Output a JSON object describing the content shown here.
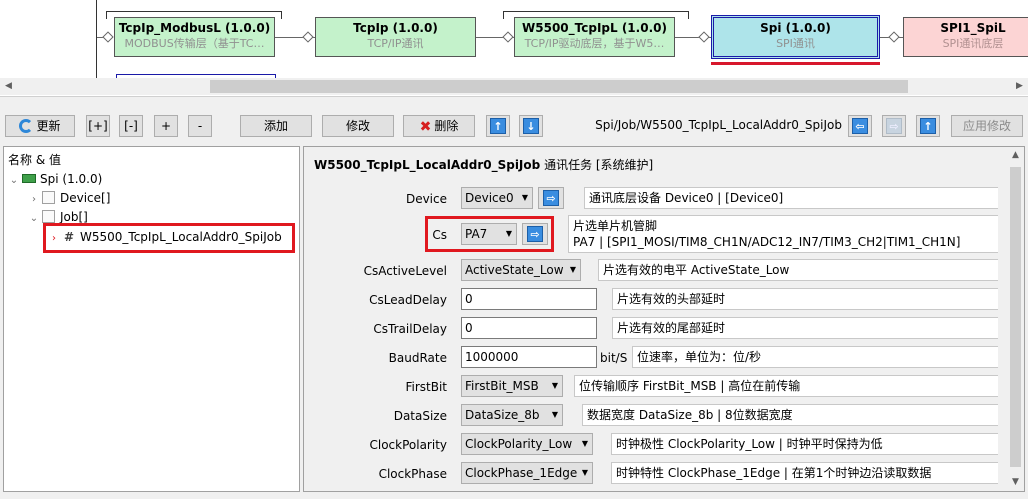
{
  "diagram": {
    "nodes": [
      {
        "title": "TcpIp_ModbusL (1.0.0)",
        "subtitle": "MODBUS传输层（基于TC…"
      },
      {
        "title": "TcpIp (1.0.0)",
        "subtitle": "TCP/IP通讯"
      },
      {
        "title": "W5500_TcpIpL (1.0.0)",
        "subtitle": "TCP/IP驱动底层，基于W5…"
      },
      {
        "title": "Spi (1.0.0)",
        "subtitle": "SPI通讯"
      },
      {
        "title": "SPI1_SpiL",
        "subtitle": "SPI通讯底层"
      }
    ]
  },
  "toolbar": {
    "refresh": "更新",
    "expand": "[+]",
    "collapse": "[-]",
    "plus": "+",
    "minus": "-",
    "add": "添加",
    "edit": "修改",
    "delete": "删除",
    "up_icon": "↑",
    "down_icon": "↓",
    "path": "Spi/Job/W5500_TcpIpL_LocalAddr0_SpiJob",
    "back_icon": "⇦",
    "forward_icon": "⇨",
    "parent_icon": "↑",
    "apply": "应用修改"
  },
  "tree": {
    "header": "名称 & 值",
    "root": "Spi (1.0.0)",
    "device": "Device[]",
    "job": "Job[]",
    "selected": "W5500_TcpIpL_LocalAddr0_SpiJob",
    "caret_open": "⌄",
    "caret_closed": "›",
    "hash": "#"
  },
  "props": {
    "title": "W5500_TcpIpL_LocalAddr0_SpiJob",
    "title_suffix": "通讯任务 [系统维护]",
    "go_icon": "⇨",
    "rows": {
      "device": {
        "label": "Device",
        "value": "Device0",
        "desc": "通讯底层设备 Device0 | [Device0]"
      },
      "cs": {
        "label": "Cs",
        "value": "PA7",
        "desc1": "片选单片机管脚",
        "desc2": "PA7 | [SPI1_MOSI/TIM8_CH1N/ADC12_IN7/TIM3_CH2|TIM1_CH1N]"
      },
      "csactive": {
        "label": "CsActiveLevel",
        "value": "ActiveState_Low",
        "desc": "片选有效的电平 ActiveState_Low"
      },
      "cslead": {
        "label": "CsLeadDelay",
        "value": "0",
        "desc": "片选有效的头部延时"
      },
      "cstrail": {
        "label": "CsTrailDelay",
        "value": "0",
        "desc": "片选有效的尾部延时"
      },
      "baud": {
        "label": "BaudRate",
        "value": "1000000",
        "unit": "bit/S",
        "desc": "位速率，单位为：位/秒"
      },
      "firstbit": {
        "label": "FirstBit",
        "value": "FirstBit_MSB",
        "desc": "位传输顺序 FirstBit_MSB | 高位在前传输"
      },
      "datasize": {
        "label": "DataSize",
        "value": "DataSize_8b",
        "desc": "数据宽度 DataSize_8b | 8位数据宽度"
      },
      "polarity": {
        "label": "ClockPolarity",
        "value": "ClockPolarity_Low",
        "desc": "时钟极性 ClockPolarity_Low | 时钟平时保持为低"
      },
      "phase": {
        "label": "ClockPhase",
        "value": "ClockPhase_1Edge",
        "desc": "时钟特性 ClockPhase_1Edge | 在第1个时钟边沿读取数据"
      }
    }
  },
  "colors": {
    "highlight": "#e0181f",
    "node_green": "#c4f2cb",
    "node_selected": "#aee4ea",
    "node_pink": "#fcd4d4"
  }
}
